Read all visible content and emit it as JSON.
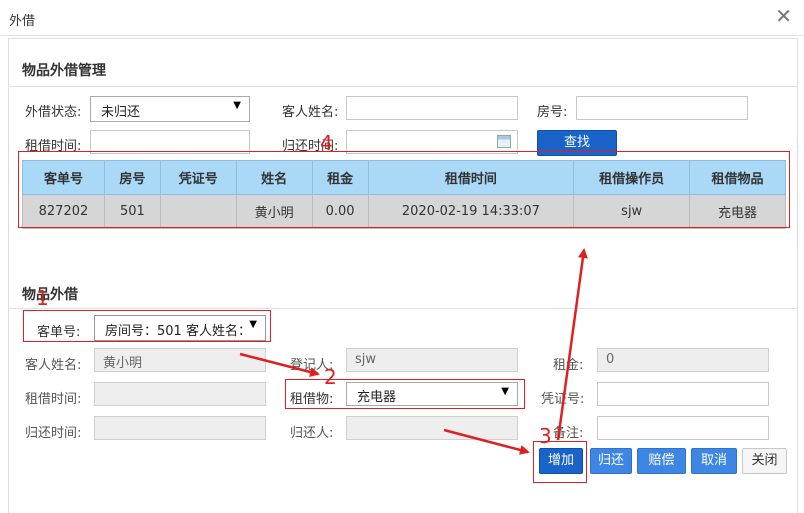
{
  "window": {
    "title": "外借"
  },
  "mgmt": {
    "section_title": "物品外借管理",
    "status_label": "外借状态:",
    "status_value": "未归还",
    "guest_label": "客人姓名:",
    "guest_value": "",
    "room_label": "房号:",
    "room_value": "",
    "rent_time_label": "租借时间:",
    "rent_time_value": "",
    "return_time_label": "归还时间:",
    "return_time_value": "",
    "search_button": "查找"
  },
  "table": {
    "headers": [
      "客单号",
      "房号",
      "凭证号",
      "姓名",
      "租金",
      "租借时间",
      "租借操作员",
      "租借物品"
    ],
    "rows": [
      [
        "827202",
        "501",
        "",
        "黄小明",
        "0.00",
        "2020-02-19 14:33:07",
        "sjw",
        "充电器"
      ]
    ]
  },
  "lend": {
    "section_title": "物品外借",
    "order_label": "客单号:",
    "order_value": "房间号：501 客人姓名：",
    "guest_label": "客人姓名:",
    "guest_value": "黄小明",
    "registrar_label": "登记人:",
    "registrar_value": "sjw",
    "deposit_label": "租金:",
    "deposit_value": "0",
    "rent_time_label": "租借时间:",
    "rent_time_value": "",
    "item_label": "租借物:",
    "item_value": "充电器",
    "voucher_label": "凭证号:",
    "voucher_value": "",
    "return_time_label": "归还时间:",
    "return_time_value": "",
    "returner_label": "归还人:",
    "returner_value": "",
    "remark_label": "备注:",
    "remark_value": ""
  },
  "buttons": {
    "add": "增加",
    "return": "归还",
    "compensate": "赔偿",
    "cancel": "取消",
    "close": "关闭"
  },
  "annotations": {
    "n1": "1",
    "n2": "2",
    "n3": "3",
    "n4": "4"
  },
  "colors": {
    "primary": "#1a63c9",
    "button_blue": "#3d86e3",
    "header_bg": "#aad8f7",
    "annotation_red": "#e02020"
  }
}
